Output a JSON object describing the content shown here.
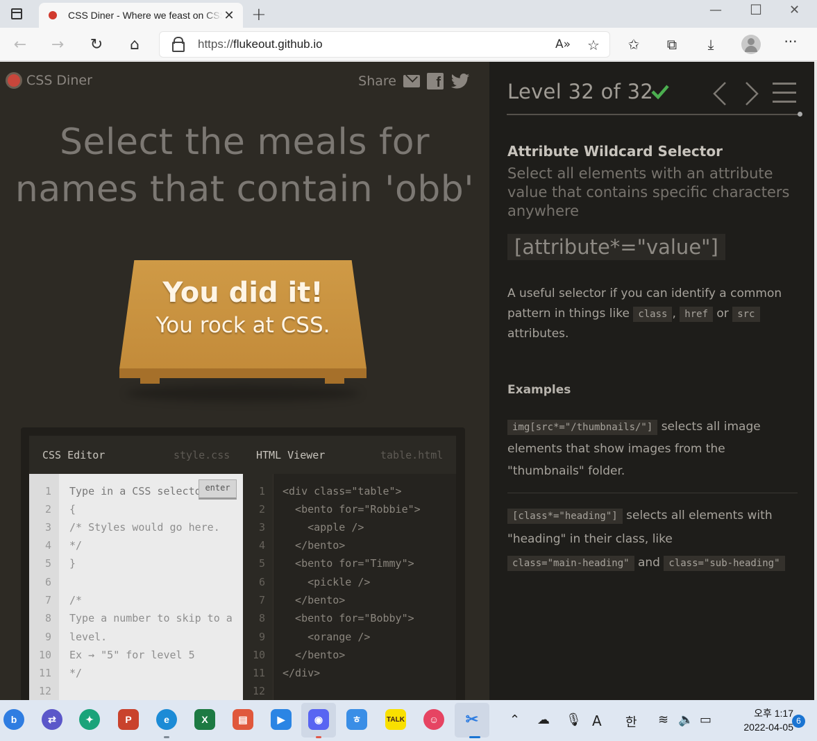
{
  "browser": {
    "tab_title": "CSS Diner - Where we feast on CSS Selectors!",
    "url_protocol": "https://",
    "url_host": "flukeout.github.io"
  },
  "page": {
    "logo_text": "CSS Diner",
    "share_label": "Share",
    "order_line1": "Select the meals for",
    "order_line2": "names that contain 'obb'",
    "win_line1": "You did it!",
    "win_line2": "You rock at CSS.",
    "editor": {
      "css_title": "CSS Editor",
      "css_file": "style.css",
      "html_title": "HTML Viewer",
      "html_file": "table.html",
      "input_placeholder": "Type in a CSS selector",
      "enter_label": "enter",
      "css_lines": [
        "{",
        "/* Styles would go here.",
        "*/",
        "}",
        "",
        "/*",
        "Type a number to skip to a",
        "level.",
        "Ex → \"5\" for level 5",
        "*/",
        ""
      ],
      "html_lines": [
        "<div class=\"table\">",
        "  <bento for=\"Robbie\">",
        "    <apple />",
        "  </bento>",
        "  <bento for=\"Timmy\">",
        "    <pickle />",
        "  </bento>",
        "  <bento for=\"Bobby\">",
        "    <orange />",
        "  </bento>",
        "</div>",
        ""
      ],
      "line_numbers": [
        "1",
        "2",
        "3",
        "4",
        "5",
        "6",
        "7",
        "8",
        "9",
        "10",
        "11",
        "12"
      ]
    },
    "sidebar": {
      "level_text": "Level 32 of 32",
      "selector_name": "Attribute Wildcard Selector",
      "selector_title": "Select all elements with an attribute value that contains specific characters anywhere",
      "syntax": "[attribute*=\"value\"]",
      "hint_1": "A useful selector if you can identify a common pattern in things like",
      "hint_tag1": "class",
      "hint_comma": ",",
      "hint_tag2": "href",
      "hint_or": "or",
      "hint_tag3": "src",
      "hint_2": "attributes.",
      "examples_header": "Examples",
      "ex1_code": "img[src*=\"/thumbnails/\"]",
      "ex1_text": "selects all image elements that show images from the \"thumbnails\" folder.",
      "ex2_code": "[class*=\"heading\"]",
      "ex2_text_1": "selects all elements with \"heading\" in their class, like",
      "ex2_code2": "class=\"main-heading\"",
      "ex2_and": "and",
      "ex2_code3": "class=\"sub-heading\""
    }
  },
  "taskbar": {
    "time": "오후 1:17",
    "date": "2022-04-05",
    "notification_count": "6",
    "ime_char": "A",
    "ime_lang": "한"
  },
  "colors": {
    "page_bg": "#2d2a24",
    "sidebar_bg": "#1e1d1a",
    "table": "#c99443",
    "check": "#4caf50"
  }
}
